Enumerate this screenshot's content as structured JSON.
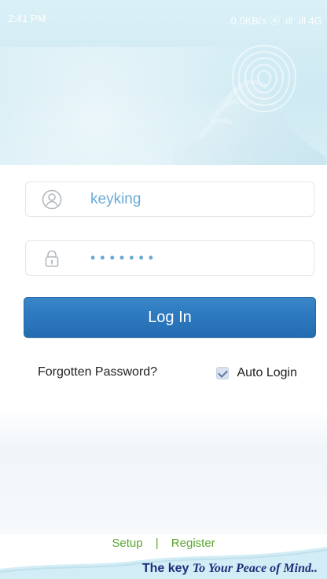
{
  "status_bar": {
    "time": "2:41 PM",
    "right": "...0.0KB/s ⓞ .ıll .ıll 4G"
  },
  "login": {
    "username_value": "keyking",
    "password_mask": "•••••••",
    "button_label": "Log In",
    "forgotten_label": "Forgotten Password?",
    "auto_login_label": "Auto Login"
  },
  "footer": {
    "setup_label": "Setup",
    "separator": "|",
    "register_label": "Register",
    "tagline_prefix": "The key",
    "tagline_italic": "To Your Peace of Mind.."
  },
  "icons": {
    "user": "user-icon",
    "lock": "lock-icon",
    "checkbox": "checkbox-icon",
    "fingerprint": "fingerprint-icon"
  },
  "colors": {
    "accent": "#2d79bf",
    "link_green": "#5aa532",
    "input_text": "#6aaad6",
    "tagline": "#1e2e7a"
  }
}
